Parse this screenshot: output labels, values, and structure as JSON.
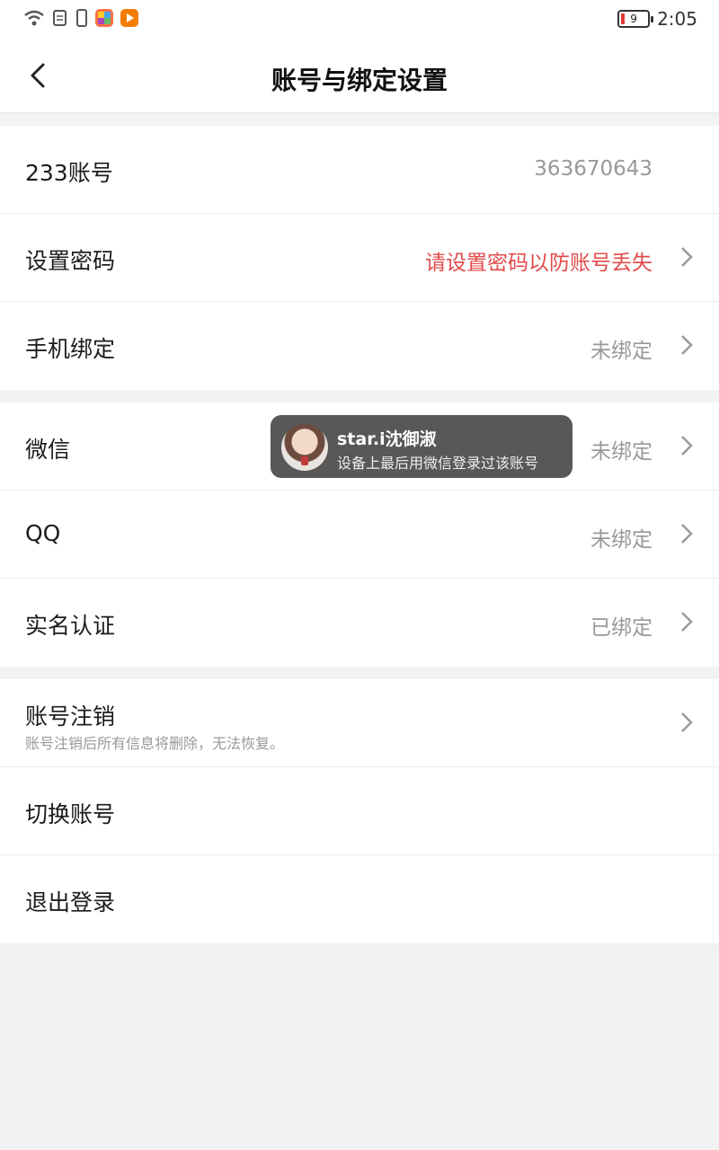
{
  "status": {
    "time": "2:05",
    "battery": "9"
  },
  "header": {
    "title": "账号与绑定设置"
  },
  "group1": [
    {
      "label": "233账号",
      "value": "363670643"
    },
    {
      "label": "设置密码",
      "value": "请设置密码以防账号丢失"
    },
    {
      "label": "手机绑定",
      "value": "未绑定"
    }
  ],
  "group2": [
    {
      "label": "微信",
      "value": "未绑定"
    },
    {
      "label": "QQ",
      "value": "未绑定"
    },
    {
      "label": "实名认证",
      "value": "已绑定"
    }
  ],
  "group3": [
    {
      "label": "账号注销",
      "sub": "账号注销后所有信息将删除，无法恢复。"
    },
    {
      "label": "切换账号"
    },
    {
      "label": "退出登录"
    }
  ],
  "toast": {
    "name": "star.i沈御淑",
    "message": "设备上最后用微信登录过该账号"
  },
  "colors": {
    "warning": "#e14b4b",
    "toast_bg": "#585858"
  }
}
